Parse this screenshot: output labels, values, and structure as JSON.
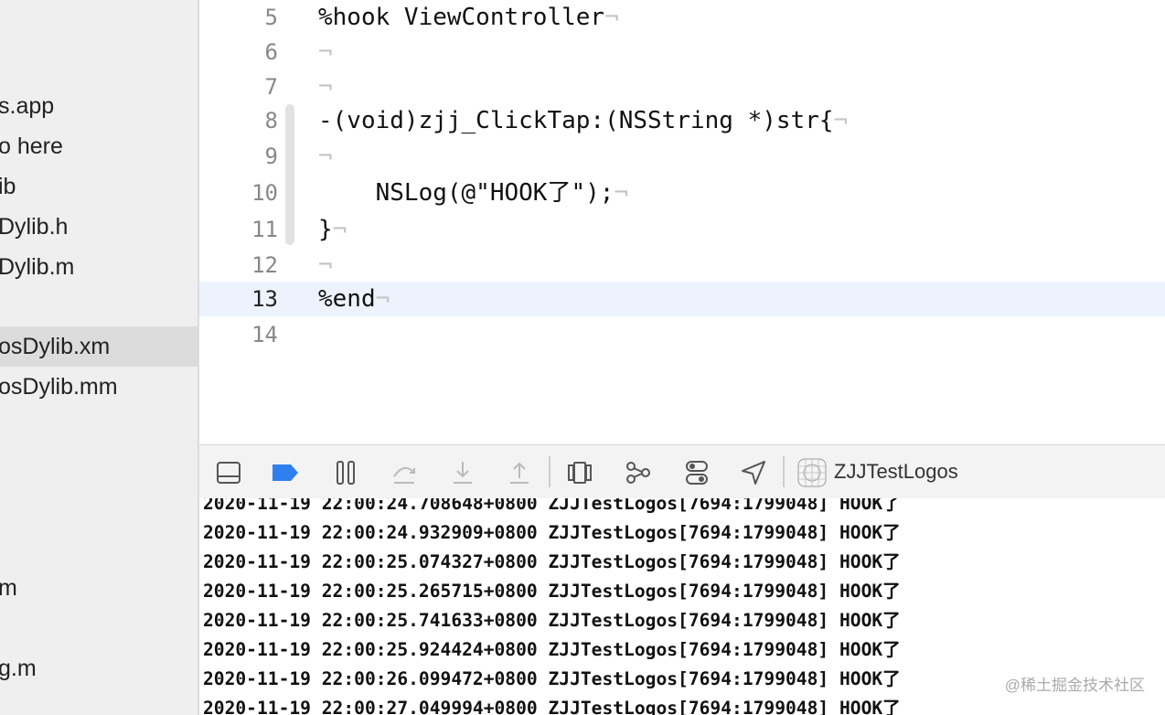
{
  "sidebar": {
    "items": [
      {
        "label": "s.app"
      },
      {
        "label": "o here"
      },
      {
        "label": "ib"
      },
      {
        "label": "Dylib.h"
      },
      {
        "label": "Dylib.m"
      },
      {
        "label": "osDylib.xm"
      },
      {
        "label": "osDylib.mm"
      },
      {
        "label": "m"
      },
      {
        "label": "g.m"
      }
    ]
  },
  "editor": {
    "lines": [
      {
        "num": "5",
        "code": "%hook ViewController",
        "inv": "¬"
      },
      {
        "num": "6",
        "code": "",
        "inv": "¬"
      },
      {
        "num": "7",
        "code": "",
        "inv": "¬"
      },
      {
        "num": "8",
        "code": "-(void)zjj_ClickTap:(NSString *)str{",
        "inv": "¬"
      },
      {
        "num": "9",
        "code": "",
        "inv": "¬"
      },
      {
        "num": "10",
        "code": "    NSLog(@\"HOOK了\");",
        "inv": "¬"
      },
      {
        "num": "11",
        "code": "}",
        "inv": "¬"
      },
      {
        "num": "12",
        "code": "",
        "inv": "¬"
      },
      {
        "num": "13",
        "code": "%end",
        "inv": "¬"
      },
      {
        "num": "14",
        "code": "",
        "inv": ""
      }
    ]
  },
  "toolbar": {
    "target_label": "ZJJTestLogos",
    "accent": "#2f7ff1"
  },
  "console": {
    "lines": [
      "2020-11-19 22:00:24.708648+0800 ZJJTestLogos[7694:1799048] HOOK了",
      "2020-11-19 22:00:24.932909+0800 ZJJTestLogos[7694:1799048] HOOK了",
      "2020-11-19 22:00:25.074327+0800 ZJJTestLogos[7694:1799048] HOOK了",
      "2020-11-19 22:00:25.265715+0800 ZJJTestLogos[7694:1799048] HOOK了",
      "2020-11-19 22:00:25.741633+0800 ZJJTestLogos[7694:1799048] HOOK了",
      "2020-11-19 22:00:25.924424+0800 ZJJTestLogos[7694:1799048] HOOK了",
      "2020-11-19 22:00:26.099472+0800 ZJJTestLogos[7694:1799048] HOOK了",
      "2020-11-19 22:00:27.049994+0800 ZJJTestLogos[7694:1799048] HOOK了"
    ]
  },
  "watermark": "@稀土掘金技术社区"
}
